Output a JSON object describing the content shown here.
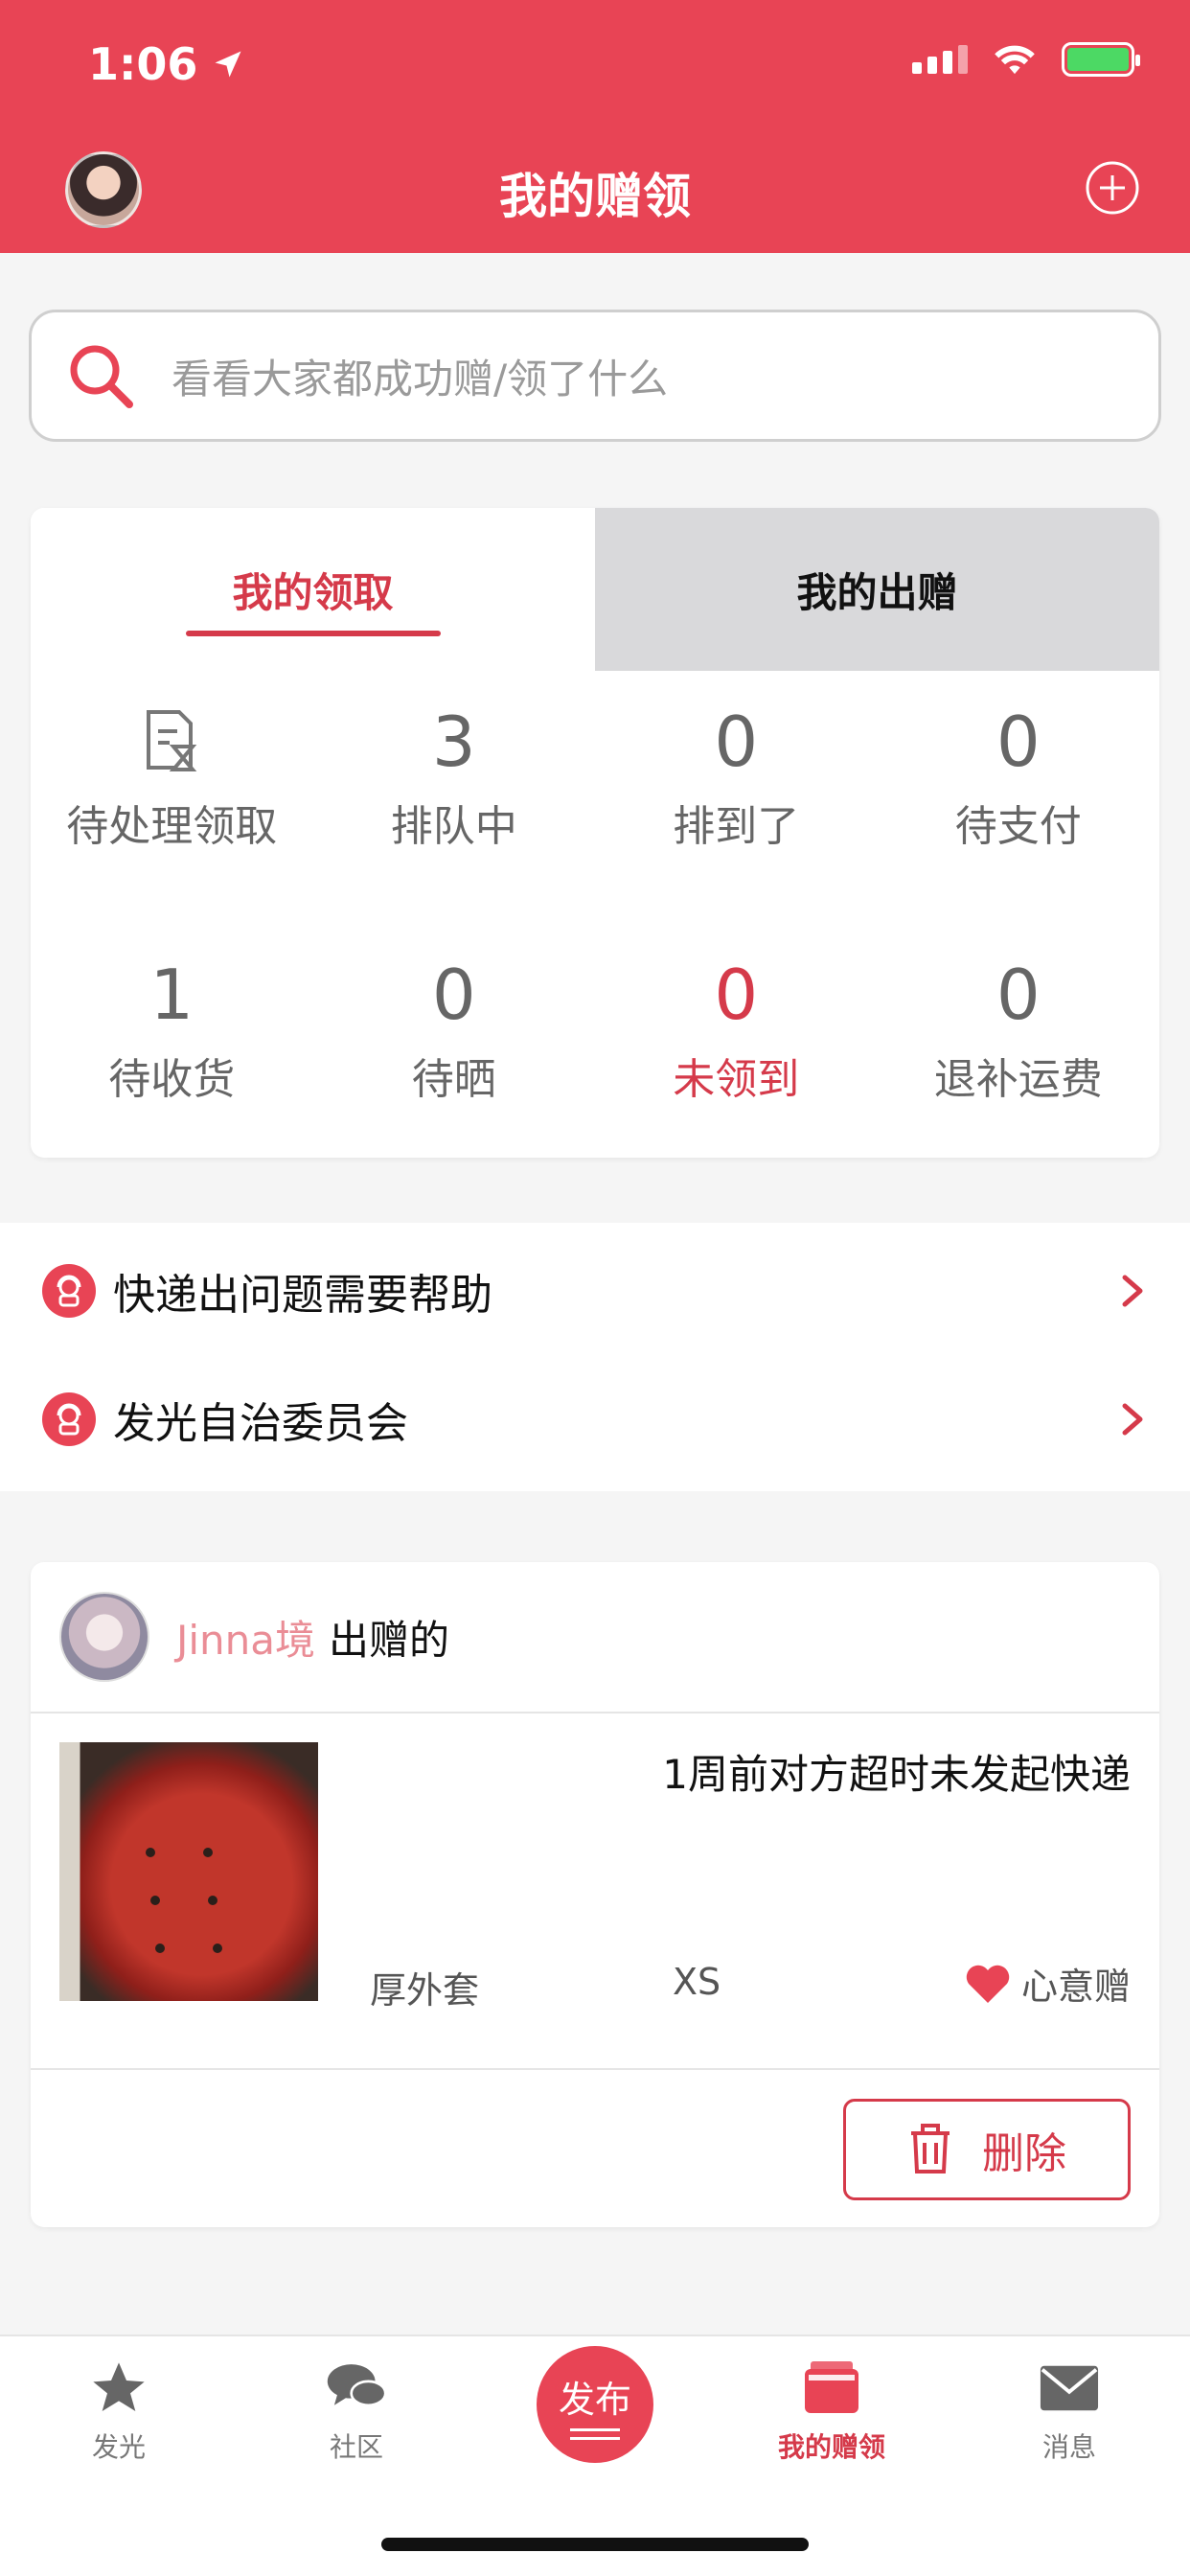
{
  "status_bar": {
    "time": "1:06"
  },
  "header": {
    "title": "我的赠领"
  },
  "search": {
    "placeholder": "看看大家都成功赠/领了什么"
  },
  "tabs": [
    {
      "label": "我的领取",
      "active": true
    },
    {
      "label": "我的出赠",
      "active": false
    }
  ],
  "stats": [
    {
      "value": "",
      "label": "待处理领取",
      "icon": "document-hourglass-icon"
    },
    {
      "value": "3",
      "label": "排队中"
    },
    {
      "value": "0",
      "label": "排到了"
    },
    {
      "value": "0",
      "label": "待支付"
    },
    {
      "value": "1",
      "label": "待收货"
    },
    {
      "value": "0",
      "label": "待晒"
    },
    {
      "value": "0",
      "label": "未领到",
      "highlight": true
    },
    {
      "value": "0",
      "label": "退补运费"
    }
  ],
  "help_links": [
    {
      "label": "快递出问题需要帮助",
      "icon": "support-agent-icon"
    },
    {
      "label": "发光自治委员会",
      "icon": "support-agent-icon"
    }
  ],
  "gift_card": {
    "giver_name": "Jinna境",
    "giver_suffix": "出赠的",
    "status": "1周前对方超时未发起快递",
    "item_type": "厚外套",
    "item_size": "XS",
    "gift_type": "心意赠",
    "delete_label": "删除"
  },
  "tabbar": [
    {
      "label": "发光",
      "icon": "star-icon"
    },
    {
      "label": "社区",
      "icon": "chat-bubbles-icon"
    },
    {
      "label": "发布",
      "icon": "publish-icon"
    },
    {
      "label": "我的赠领",
      "icon": "wallet-icon",
      "active": true
    },
    {
      "label": "消息",
      "icon": "envelope-icon"
    }
  ],
  "colors": {
    "brand": "#e84455",
    "accent_text": "#d53a4a",
    "giver_name": "#ea8d96"
  }
}
